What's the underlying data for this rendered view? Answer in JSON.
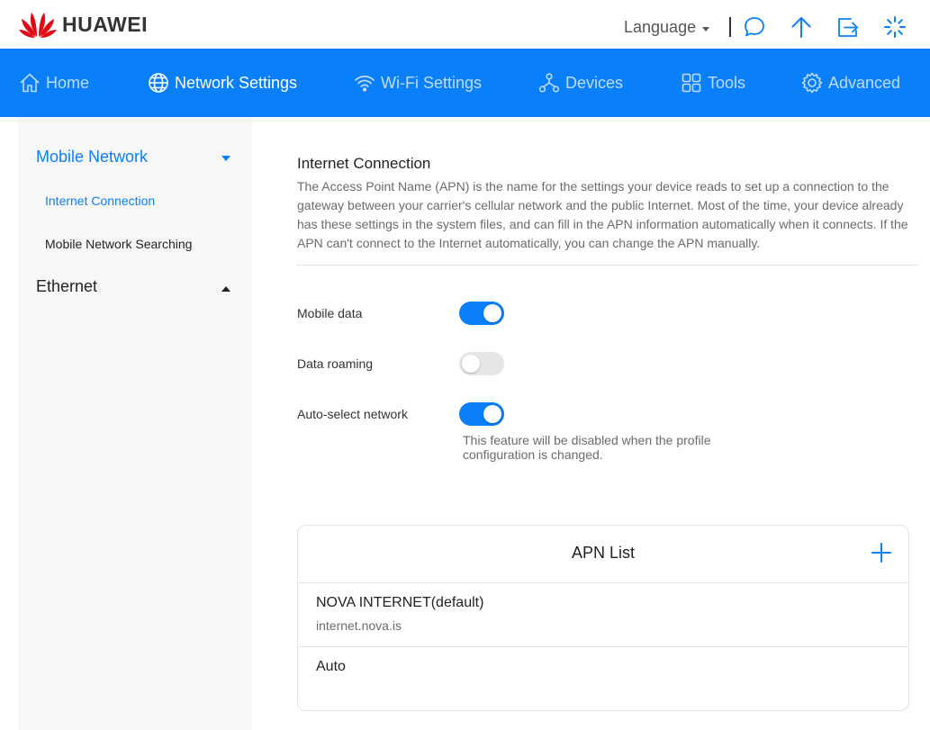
{
  "brand": {
    "name": "HUAWEI",
    "color": "#e30613"
  },
  "header": {
    "language_label": "Language",
    "icons": [
      "message-icon",
      "upload-icon",
      "logout-icon",
      "loading-icon"
    ]
  },
  "nav": {
    "accent": "#0a7ffa",
    "items": [
      {
        "label": "Home",
        "icon": "home-icon",
        "active": false
      },
      {
        "label": "Network Settings",
        "icon": "globe-icon",
        "active": true
      },
      {
        "label": "Wi-Fi Settings",
        "icon": "wifi-icon",
        "active": false
      },
      {
        "label": "Devices",
        "icon": "devices-icon",
        "active": false
      },
      {
        "label": "Tools",
        "icon": "tools-icon",
        "active": false
      },
      {
        "label": "Advanced",
        "icon": "gear-icon",
        "active": false
      }
    ]
  },
  "sidebar": {
    "groups": [
      {
        "label": "Mobile Network",
        "expanded": true,
        "items": [
          {
            "label": "Internet Connection",
            "active": true
          },
          {
            "label": "Mobile Network Searching",
            "active": false
          }
        ]
      },
      {
        "label": "Ethernet",
        "expanded": false,
        "items": []
      }
    ]
  },
  "main": {
    "title": "Internet Connection",
    "description": "The Access Point Name (APN) is the name for the settings your device reads to set up a connection to the gateway between your carrier's cellular network and the public Internet. Most of the time, your device already has these settings in the system files, and can fill in the APN information automatically when it connects. If the APN can't connect to the Internet automatically, you can change the APN manually.",
    "settings": [
      {
        "label": "Mobile data",
        "enabled": true
      },
      {
        "label": "Data roaming",
        "enabled": false
      },
      {
        "label": "Auto-select network",
        "enabled": true
      }
    ],
    "auto_select_note": "This feature will be disabled when the profile configuration is changed."
  },
  "apn_list": {
    "title": "APN List",
    "items": [
      {
        "name": "NOVA INTERNET(default)",
        "apn": "internet.nova.is"
      },
      {
        "name": "Auto",
        "apn": ""
      }
    ]
  }
}
